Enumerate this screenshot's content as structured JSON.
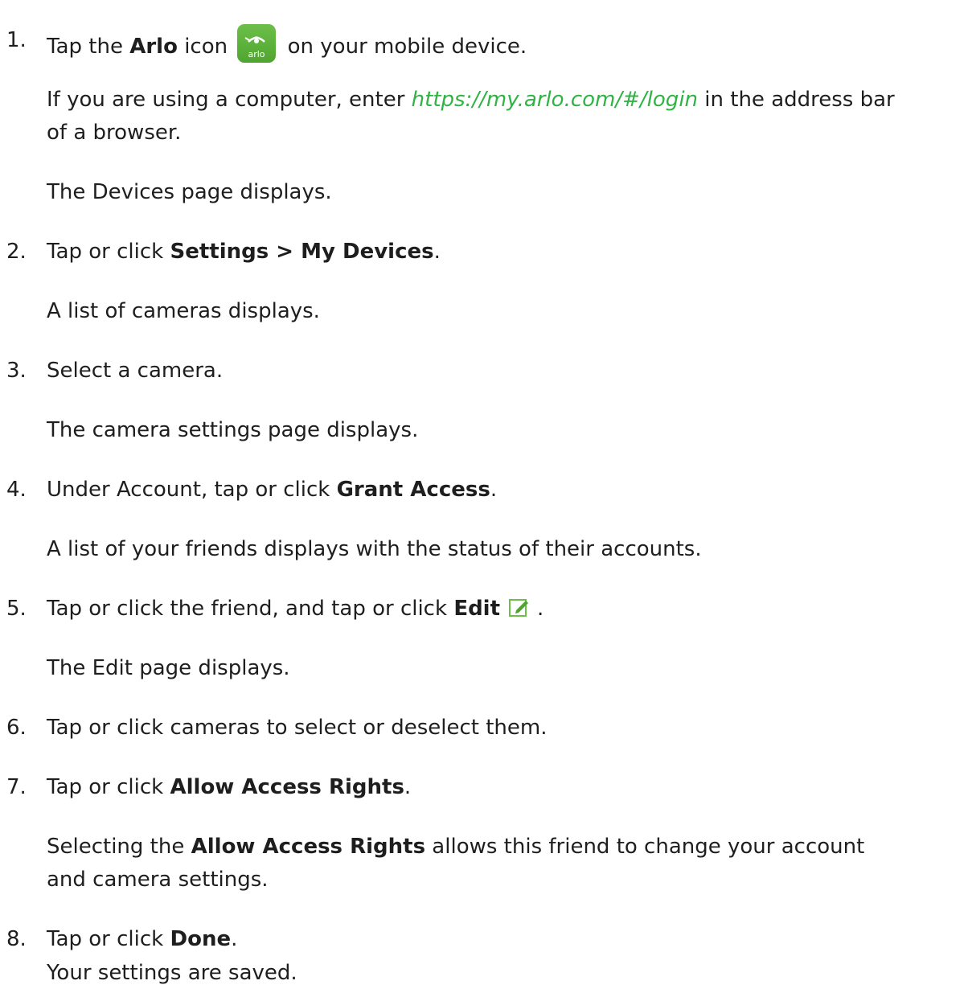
{
  "steps": [
    {
      "num": "1.",
      "pre": "Tap the ",
      "bold": "Arlo",
      "mid": " icon ",
      "post": " on your mobile device.",
      "note_pre": "If you are using a computer, enter ",
      "note_link": "https://my.arlo.com/#/login",
      "note_post": " in the address bar",
      "note_line2": "of a browser.",
      "result": "The Devices page displays."
    },
    {
      "num": "2.",
      "pre": "Tap or click ",
      "bold": "Settings > My Devices",
      "post": ".",
      "result": "A list of cameras displays."
    },
    {
      "num": "3.",
      "text": "Select a camera.",
      "result": "The camera settings  page displays."
    },
    {
      "num": "4.",
      "pre": "Under Account, tap or click ",
      "bold": "Grant Access",
      "post": ".",
      "result": "A list of your friends displays with the status of their accounts."
    },
    {
      "num": "5.",
      "pre": "Tap or click the friend, and tap or click ",
      "bold": "Edit",
      "post": ".",
      "result": "The Edit page displays."
    },
    {
      "num": "6.",
      "text": "Tap or click cameras to select or deselect them."
    },
    {
      "num": "7.",
      "pre": "Tap or click ",
      "bold": "Allow Access Rights",
      "post": ".",
      "result_pre": "Selecting the ",
      "result_bold": "Allow Access Rights",
      "result_post": " allows this friend to change your account",
      "result_line2": "and camera settings."
    },
    {
      "num": "8.",
      "pre": "Tap or click ",
      "bold": "Done",
      "post": ".",
      "result": "Your settings are saved."
    }
  ],
  "icons": {
    "arlo_icon_label": "arlo",
    "edit_icon": "pencil-edit-icon"
  },
  "colors": {
    "link": "#2fb344",
    "arlo_green": "#5db53a"
  }
}
